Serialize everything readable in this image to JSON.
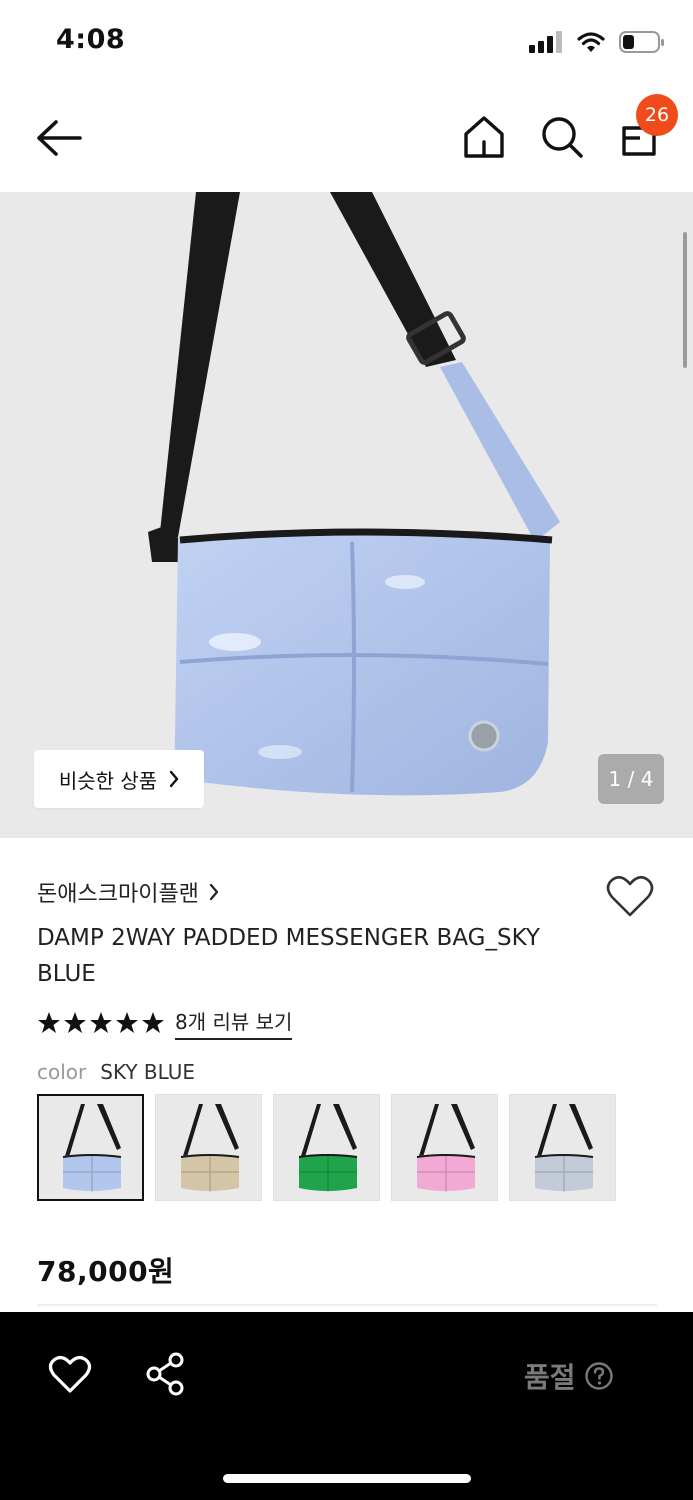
{
  "status_bar": {
    "time": "4:08"
  },
  "nav": {
    "cart_count": "26"
  },
  "gallery": {
    "similar_label": "비슷한 상품",
    "page_indicator": "1 / 4"
  },
  "product": {
    "brand": "돈애스크마이플랜",
    "title": "DAMP 2WAY PADDED MESSENGER BAG_SKY BLUE",
    "rating_stars": 5,
    "review_link": "8개 리뷰 보기",
    "color_label": "color",
    "color_value": "SKY BLUE",
    "swatches": [
      {
        "name": "sky blue",
        "color": "#b3c6ec"
      },
      {
        "name": "beige",
        "color": "#d4c5a6"
      },
      {
        "name": "green",
        "color": "#1fa44c"
      },
      {
        "name": "pink",
        "color": "#f2a9d4"
      },
      {
        "name": "silver",
        "color": "#c3cad8"
      }
    ],
    "price": "78,000원"
  },
  "bottom_bar": {
    "soldout_label": "품절"
  },
  "colors": {
    "badge": "#f04b1b",
    "bag_main": "#b3c6ec",
    "strap": "#1a1a1a"
  }
}
